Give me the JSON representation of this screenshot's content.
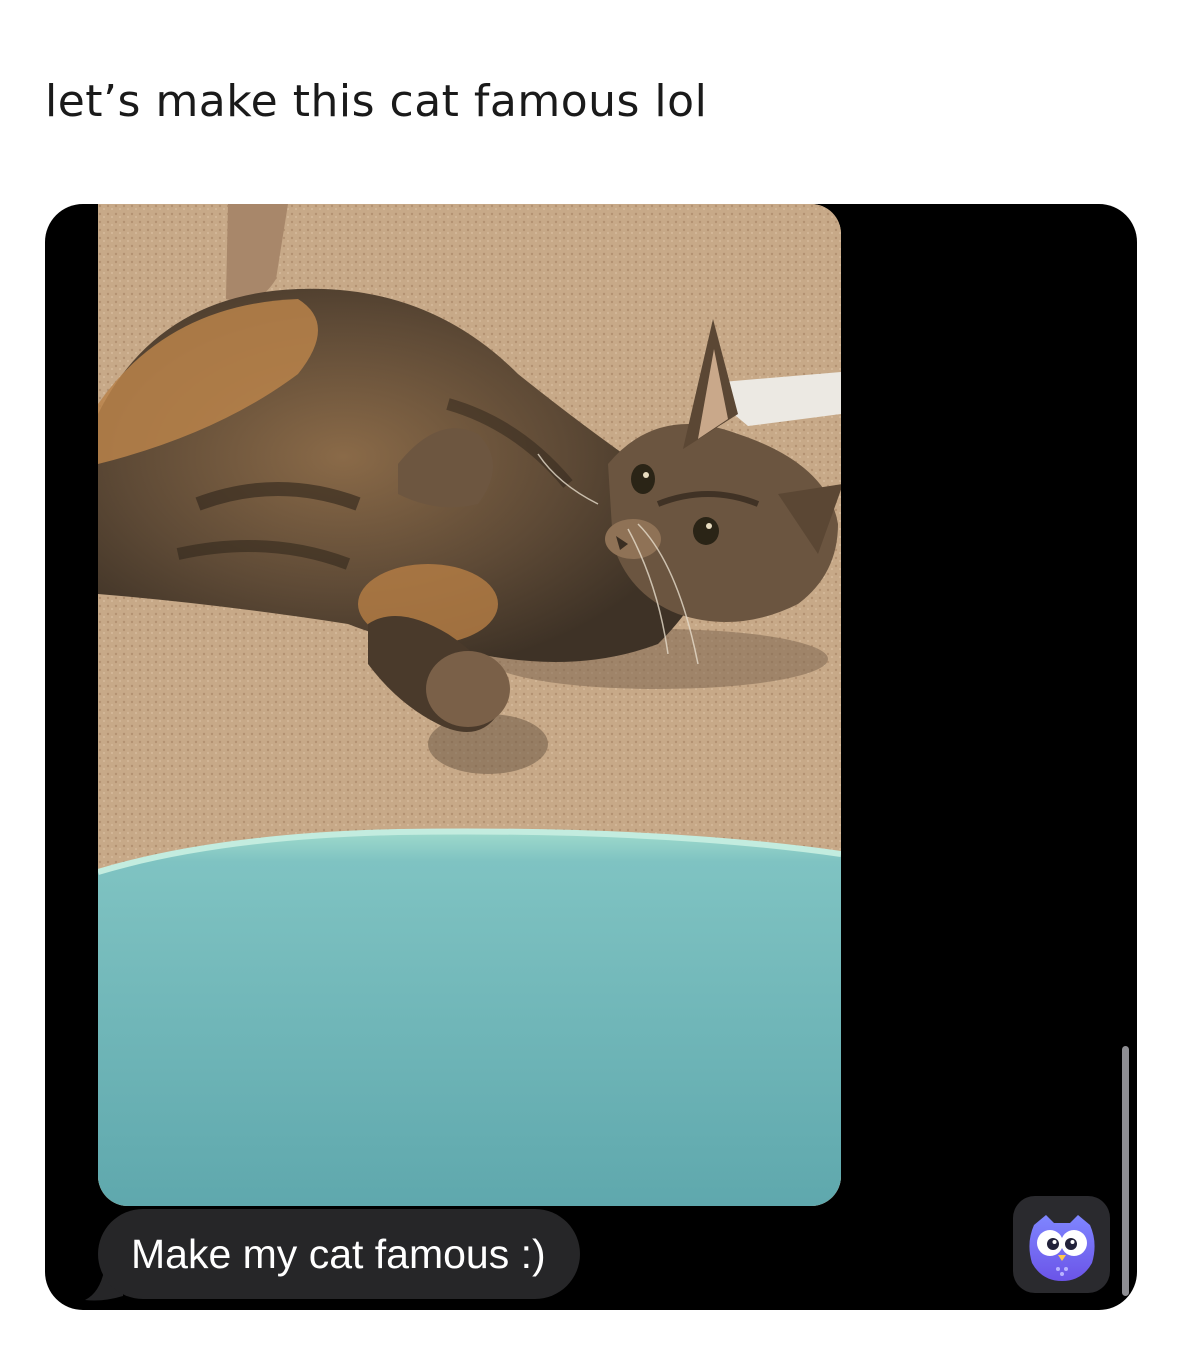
{
  "post": {
    "caption": "let’s make this cat famous lol"
  },
  "conversation": {
    "photo_subject": "cat-photo",
    "message_text": "Make my cat famous :)",
    "colors": {
      "background": "#000000",
      "bubble": "#262628",
      "bubble_text": "#ffffff"
    }
  },
  "overlay": {
    "app_icon": "owl-icon"
  }
}
